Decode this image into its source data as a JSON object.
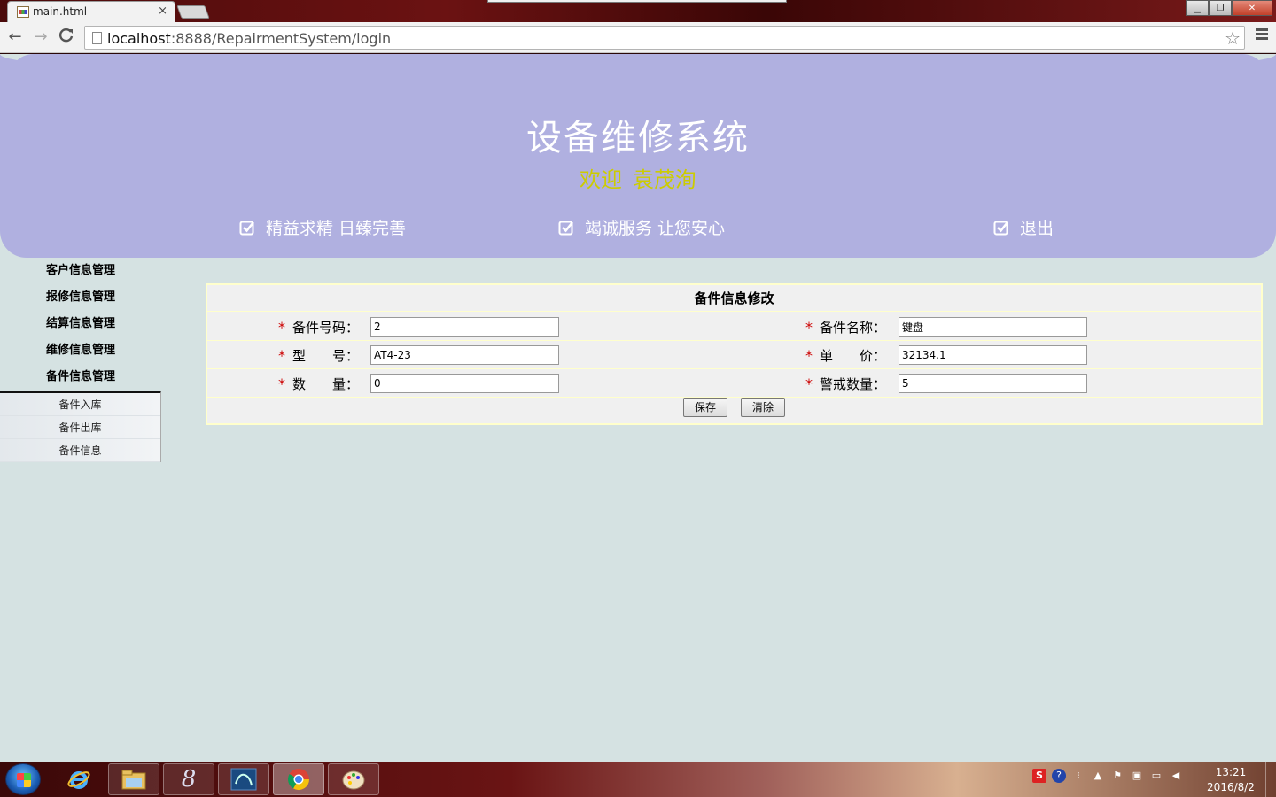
{
  "browser": {
    "tab_title": "main.html",
    "tab_close": "×",
    "url_host": "localhost",
    "url_rest": ":8888/RepairmentSystem/login",
    "back": "←",
    "forward": "→",
    "reload": "C"
  },
  "banner": {
    "title": "设备维修系统",
    "welcome_label": "欢迎",
    "user_name": "袁茂洵",
    "slogan_1": "精益求精  日臻完善",
    "slogan_2": "竭诚服务  让您安心",
    "logout": "退出"
  },
  "sidebar": {
    "items": [
      "客户信息管理",
      "报修信息管理",
      "结算信息管理",
      "维修信息管理",
      "备件信息管理"
    ],
    "sub_items": [
      "备件入库",
      "备件出库",
      "备件信息"
    ]
  },
  "form": {
    "title": "备件信息修改",
    "required_mark": "*",
    "part_no_label": "备件号码：",
    "part_no_value": "2",
    "part_name_label": "备件名称：",
    "part_name_value": "键盘",
    "model_label": "型　　号：",
    "model_value": "AT4-23",
    "price_label": "单　　价：",
    "price_value": "32134.1",
    "qty_label": "数　　量：",
    "qty_value": "0",
    "alert_qty_label": "警戒数量：",
    "alert_qty_value": "5",
    "save_button": "保存",
    "clear_button": "清除"
  },
  "taskbar": {
    "time": "13:21",
    "date": "2016/8/2"
  }
}
